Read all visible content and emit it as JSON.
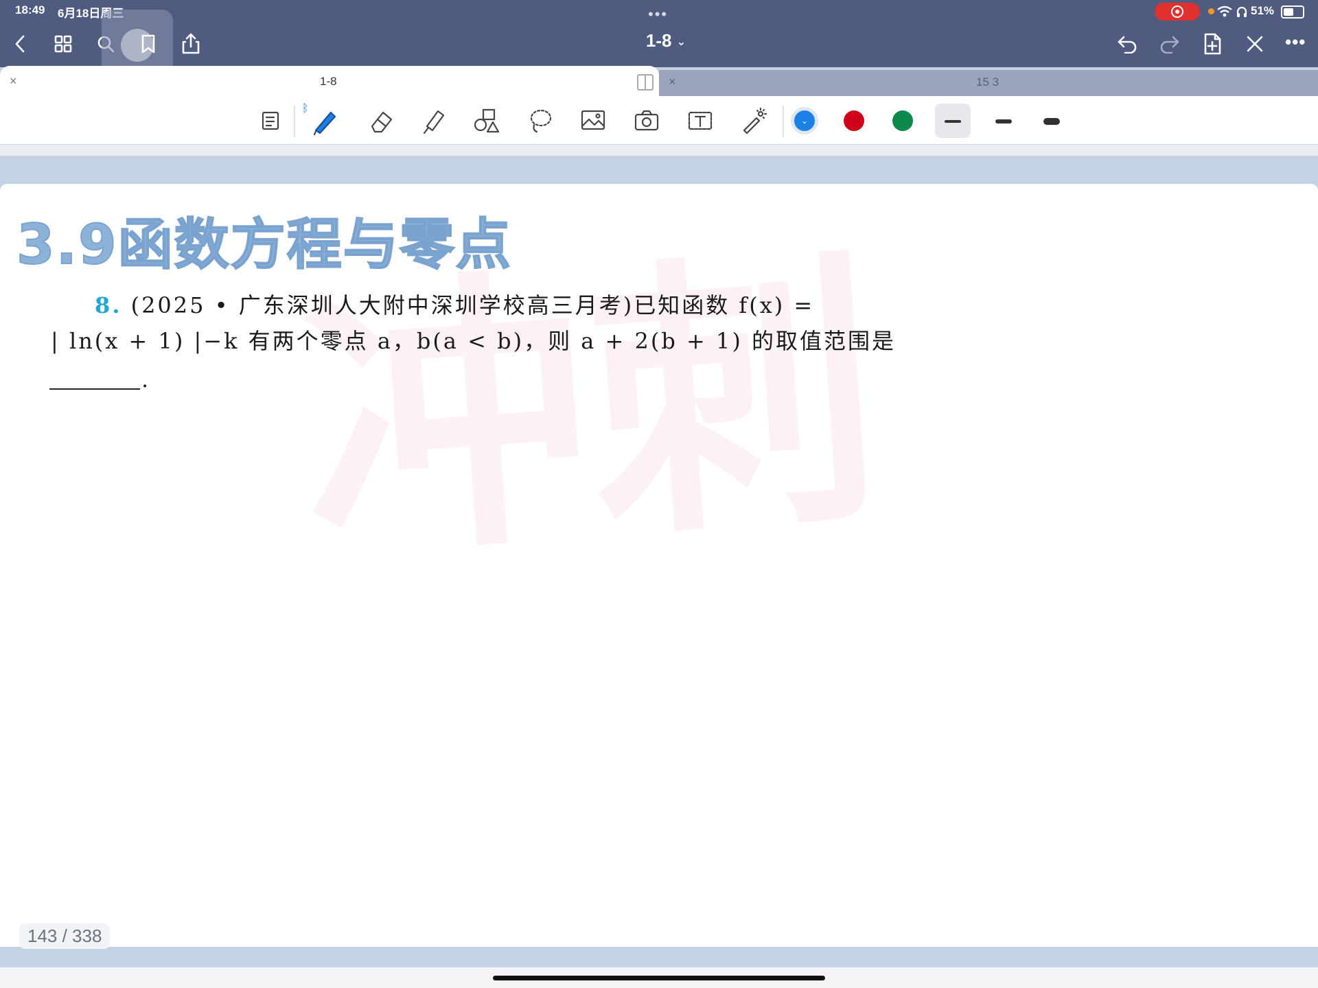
{
  "status_bar": {
    "time": "18:49",
    "date": "6月18日周三",
    "battery": "51%"
  },
  "nav": {
    "document_title": "1-8"
  },
  "tabs": [
    {
      "label": "1-8",
      "active": true
    },
    {
      "label": "15 3",
      "active": false
    }
  ],
  "toolbar": {
    "tools": [
      "page-mode",
      "pen",
      "eraser",
      "highlighter",
      "shapes",
      "lasso",
      "image",
      "camera",
      "text",
      "laser-pointer"
    ],
    "colors": [
      "#1a7fe6",
      "#d0021b",
      "#0b8a4b"
    ],
    "selected_color": "#1a7fe6"
  },
  "document": {
    "section_title": "3.9函数方程与零点",
    "problem": {
      "number": "8.",
      "line1": "(2025 • 广东深圳人大附中深圳学校高三月考)已知函数 f(x) =",
      "line2": "| ln(x + 1) |−k 有两个零点 a，b(a < b)，则 a + 2(b + 1) 的取值范围是",
      "line3": "."
    },
    "watermark": "冲刺"
  },
  "page_indicator": "143 / 338"
}
